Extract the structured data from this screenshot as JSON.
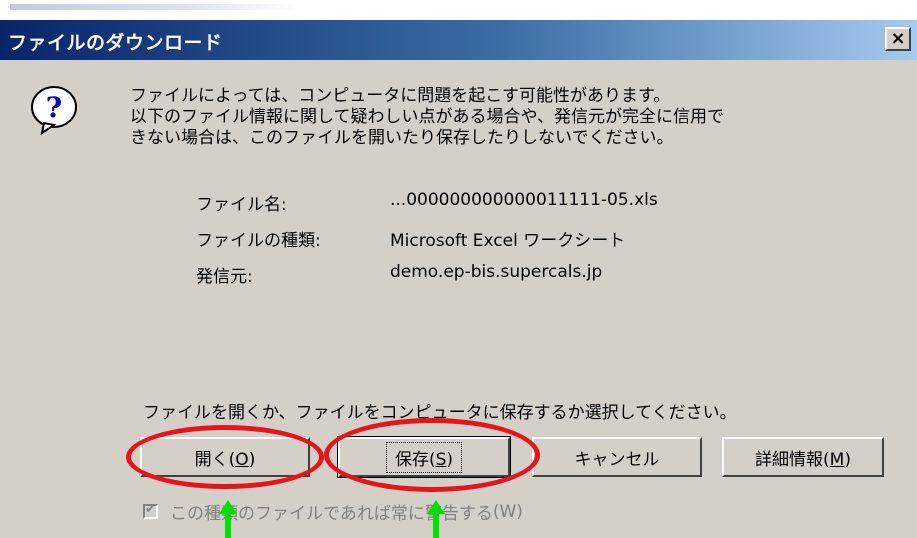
{
  "dialog": {
    "title": "ファイルのダウンロード",
    "close_label": "×",
    "icon": "question-icon",
    "message_lines": [
      "ファイルによっては、コンピュータに問題を起こす可能性があります。",
      "以下のファイル情報に関して疑わしい点がある場合や、発信元が完全に信用で",
      "きない場合は、このファイルを開いたり保存したりしないでください。"
    ],
    "file_info": [
      {
        "label": "ファイル名:",
        "value": "...000000000000011111-05.xls"
      },
      {
        "label": "ファイルの種類:",
        "value": "Microsoft Excel ワークシート"
      },
      {
        "label": "発信元:",
        "value": "demo.ep-bis.supercals.jp"
      }
    ],
    "prompt": "ファイルを開くか、ファイルをコンピュータに保存するか選択してください。",
    "buttons": {
      "open": {
        "text": "開く(",
        "key": "O",
        "end": ")"
      },
      "save": {
        "text": "保存(",
        "key": "S",
        "end": ")"
      },
      "cancel": {
        "text": "キャンセル"
      },
      "details": {
        "text": "詳細情報(",
        "key": "M",
        "end": ")"
      }
    },
    "checkbox": {
      "label": "この種類のファイルであれば常に警告する",
      "key_part": "(W)",
      "checked": true,
      "enabled": false
    }
  },
  "annotations": {
    "circle_color": "#e8141c",
    "arrow_color": "#00e000"
  }
}
